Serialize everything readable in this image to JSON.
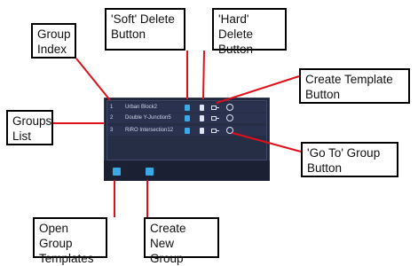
{
  "callouts": {
    "group_index": "Group\nIndex",
    "soft_delete": "'Soft' Delete\nButton",
    "hard_delete": "'Hard' Delete\nButton",
    "create_template": "Create Template\nButton",
    "groups_list": "Groups\nList",
    "goto_group": "'Go To' Group\nButton",
    "open_templates": "Open Group\nTemplates",
    "create_new_group": "Create New\nGroup"
  },
  "groups": [
    {
      "index": "1",
      "name": "Urban Block2"
    },
    {
      "index": "2",
      "name": "Double Y-Junction5"
    },
    {
      "index": "3",
      "name": "RiRO Intersection12"
    }
  ],
  "colors": {
    "arrow": "#e0101a",
    "panel": "#20273a",
    "accent": "#39a9e8"
  }
}
